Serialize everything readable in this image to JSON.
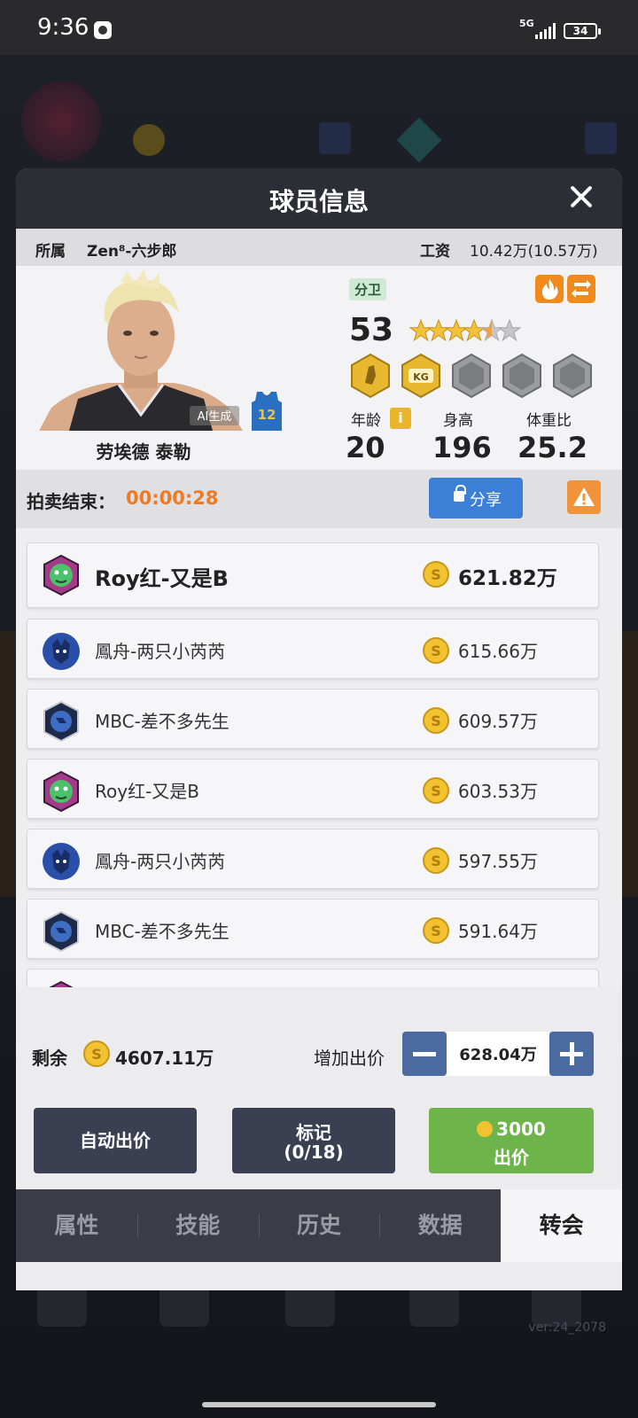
{
  "status_bar": {
    "time": "9:36",
    "network": "5G",
    "battery": "34"
  },
  "modal": {
    "title": "球员信息"
  },
  "info_row": {
    "team_label": "所属",
    "team_value": "Zen⁸-六步郎",
    "salary_label": "工资",
    "salary_value": "10.42万(10.57万)"
  },
  "player": {
    "name": "劳埃德 泰勒",
    "ai_tag": "AI生成",
    "jersey_number": "12",
    "position": "分卫",
    "rating": "53",
    "stars": 4.5,
    "stats": [
      {
        "label": "年龄",
        "value": "20"
      },
      {
        "label": "身高",
        "value": "196"
      },
      {
        "label": "体重比",
        "value": "25.2"
      }
    ],
    "info_icon_glyph": "i"
  },
  "auction": {
    "end_label": "拍卖结束：",
    "timer": "00:00:28",
    "share_label": "分享"
  },
  "bids": [
    {
      "team": "Roy红-又是B",
      "amount": "621.82万",
      "logo": "green-bear",
      "top": true
    },
    {
      "team": "鳳舟-两只小芮芮",
      "amount": "615.66万",
      "logo": "blue-wolf",
      "top": false
    },
    {
      "team": "MBC-差不多先生",
      "amount": "609.57万",
      "logo": "blue-lion",
      "top": false
    },
    {
      "team": "Roy红-又是B",
      "amount": "603.53万",
      "logo": "green-bear",
      "top": false
    },
    {
      "team": "鳳舟-两只小芮芮",
      "amount": "597.55万",
      "logo": "blue-wolf",
      "top": false
    },
    {
      "team": "MBC-差不多先生",
      "amount": "591.64万",
      "logo": "blue-lion",
      "top": false
    }
  ],
  "bottom": {
    "remain_label": "剩余",
    "remain_value": "4607.11万",
    "increase_label": "增加出价",
    "bid_value": "628.04万",
    "auto_bid_label": "自动出价",
    "mark_label": "标记",
    "mark_count": "(0/18)",
    "place_bid_amount": "3000",
    "place_bid_label": "出价"
  },
  "tabs": [
    {
      "label": "属性",
      "active": false
    },
    {
      "label": "技能",
      "active": false
    },
    {
      "label": "历史",
      "active": false
    },
    {
      "label": "数据",
      "active": false
    },
    {
      "label": "转会",
      "active": true
    }
  ],
  "background": {
    "version": "ver:24_2078"
  },
  "colors": {
    "accent_orange": "#f07a22",
    "share_blue": "#3c7fd6",
    "bid_green": "#6db54a",
    "dark_button": "#3a3f52"
  }
}
